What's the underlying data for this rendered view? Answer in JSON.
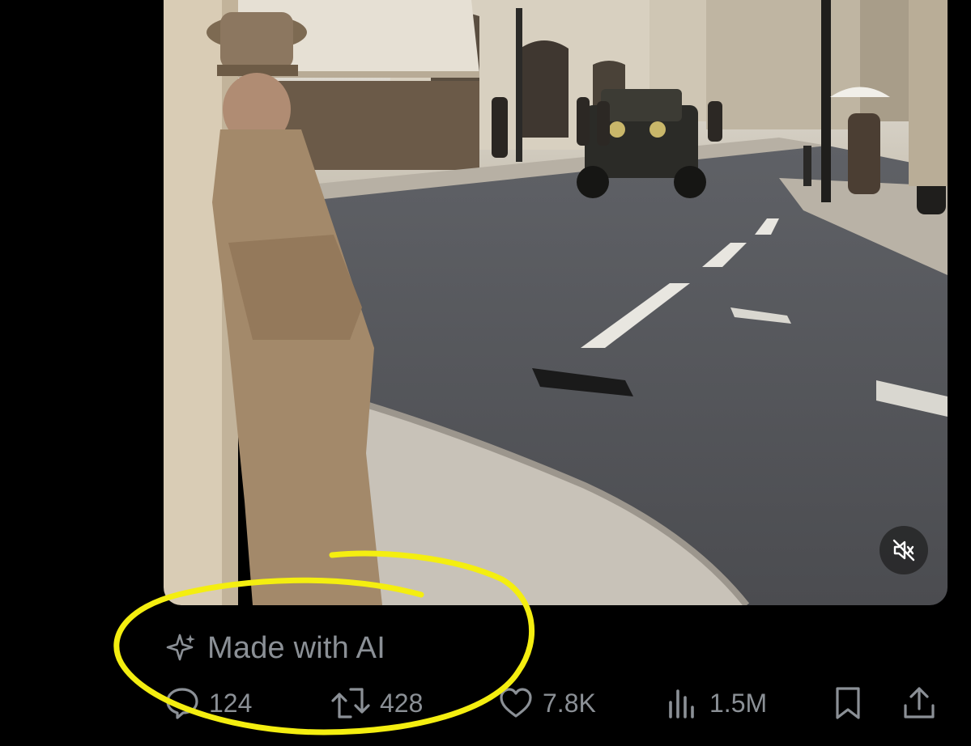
{
  "media": {
    "alt": "street-scene-video",
    "mute_icon": "speaker-muted-icon"
  },
  "ai_label": {
    "icon": "sparkle-icon",
    "text": "Made with AI"
  },
  "actions": {
    "reply": {
      "icon": "speech-bubble-icon",
      "count": "124"
    },
    "repost": {
      "icon": "repost-arrows-icon",
      "count": "428"
    },
    "like": {
      "icon": "heart-icon",
      "count": "7.8K"
    },
    "views": {
      "icon": "bar-chart-icon",
      "count": "1.5M"
    },
    "bookmark": {
      "icon": "bookmark-icon"
    },
    "share": {
      "icon": "share-upload-icon"
    }
  },
  "colors": {
    "background": "#000000",
    "muted_text": "#8b9096",
    "highlight": "#f4ee10"
  }
}
